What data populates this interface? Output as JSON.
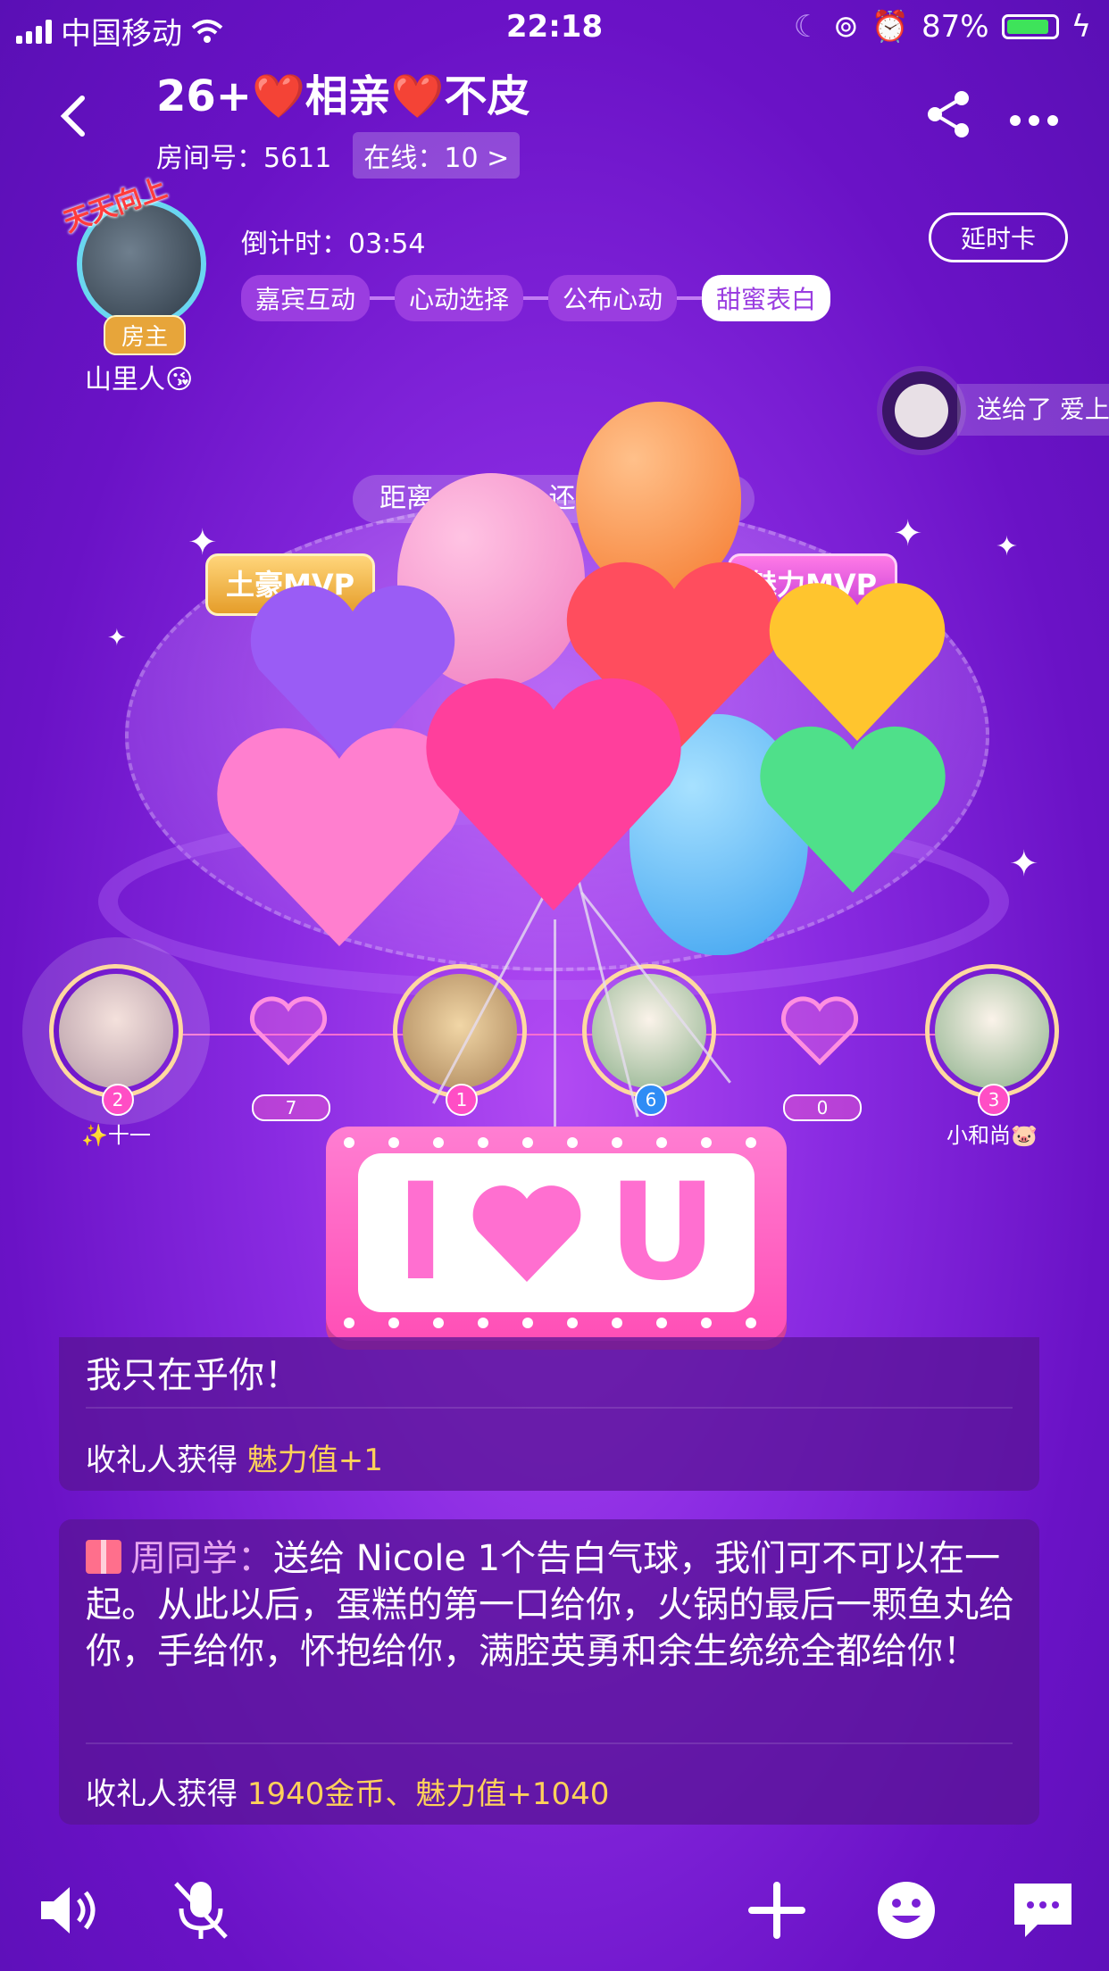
{
  "status_bar": {
    "carrier": "中国移动",
    "time": "22:18",
    "battery": "87%"
  },
  "header": {
    "room_title": "26+❤️相亲❤️不皮",
    "room_id_label": "房间号：5611",
    "online_label": "在线：10 >"
  },
  "host": {
    "badge": "房主",
    "crown_text": "天天向上",
    "name": "山里人😘"
  },
  "session": {
    "countdown": "倒计时：03:54",
    "extend_button": "延时卡",
    "steps": [
      "嘉宾互动",
      "心动选择",
      "公布心动",
      "甜蜜表白"
    ],
    "active_step": "甜蜜表白"
  },
  "ticker": {
    "text": "送给了 爱上"
  },
  "stage": {
    "distance_text": "距离",
    "distance_suffix": "还",
    "mvp_rich": "土豪MVP",
    "mvp_charm": "魅力MVP"
  },
  "seats": [
    {
      "number": "2",
      "name": "✨十一"
    },
    {
      "number": "1",
      "name": ""
    },
    {
      "number": "6",
      "name": ""
    },
    {
      "number": "3",
      "name": "小和尚🐷"
    }
  ],
  "heart_counts": [
    "7",
    "0"
  ],
  "effect": {
    "left": "I",
    "right": "U"
  },
  "messages": [
    {
      "body": "我只在乎你！",
      "reward_prefix": "收礼人获得 ",
      "reward_value": "魅力值+1"
    },
    {
      "sender": "周同学：",
      "body": "送给 Nicole 1个告白气球，我们可不可以在一起。从此以后，蛋糕的第一口给你，火锅的最后一颗鱼丸给你，手给你，怀抱给你，满腔英勇和余生统统全都给你！",
      "reward_prefix": "收礼人获得 ",
      "reward_value": "1940金币、魅力值+1040"
    }
  ],
  "colors": {
    "background": "#7a1fd6",
    "accent_pink": "#ff6fd0",
    "gold_text": "#ffd15a",
    "active_step_bg": "#ffffff"
  }
}
